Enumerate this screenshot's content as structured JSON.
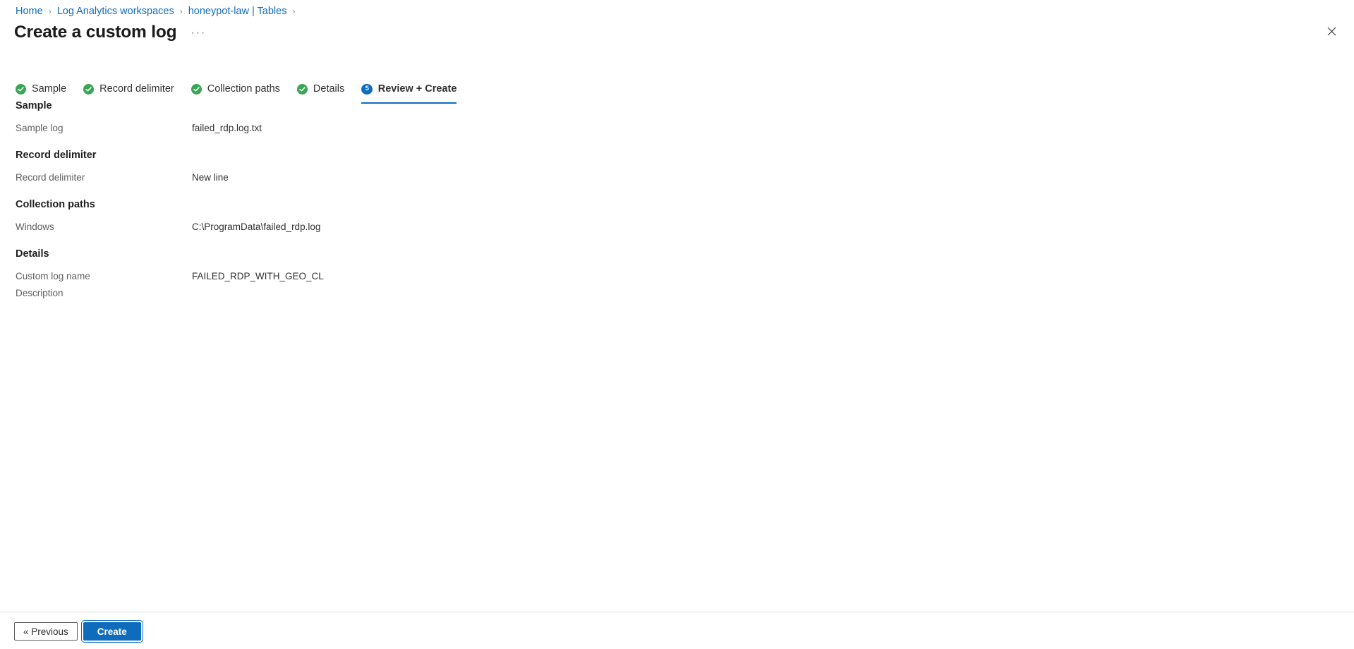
{
  "breadcrumb": {
    "items": [
      {
        "label": "Home"
      },
      {
        "label": "Log Analytics workspaces"
      },
      {
        "label": "honeypot-law | Tables"
      }
    ],
    "separator": "›"
  },
  "header": {
    "title": "Create a custom log",
    "more_menu": "···",
    "close_icon": "close-icon"
  },
  "tabs": [
    {
      "label": "Sample",
      "state": "done",
      "badge": "✓"
    },
    {
      "label": "Record delimiter",
      "state": "done",
      "badge": "✓"
    },
    {
      "label": "Collection paths",
      "state": "done",
      "badge": "✓"
    },
    {
      "label": "Details",
      "state": "done",
      "badge": "✓"
    },
    {
      "label": "Review + Create",
      "state": "active",
      "badge": "5"
    }
  ],
  "sections": [
    {
      "title": "Sample",
      "rows": [
        {
          "label": "Sample log",
          "value": "failed_rdp.log.txt"
        }
      ]
    },
    {
      "title": "Record delimiter",
      "rows": [
        {
          "label": "Record delimiter",
          "value": "New line"
        }
      ]
    },
    {
      "title": "Collection paths",
      "rows": [
        {
          "label": "Windows",
          "value": "C:\\ProgramData\\failed_rdp.log"
        }
      ]
    },
    {
      "title": "Details",
      "rows": [
        {
          "label": "Custom log name",
          "value": "FAILED_RDP_WITH_GEO_CL"
        },
        {
          "label": "Description",
          "value": ""
        }
      ]
    }
  ],
  "footer": {
    "previous_label": "« Previous",
    "create_label": "Create"
  },
  "colors": {
    "link": "#0f6cbd",
    "accent": "#0f6cbd",
    "success": "#3aa655",
    "text": "#323130",
    "muted": "#605e5c"
  }
}
